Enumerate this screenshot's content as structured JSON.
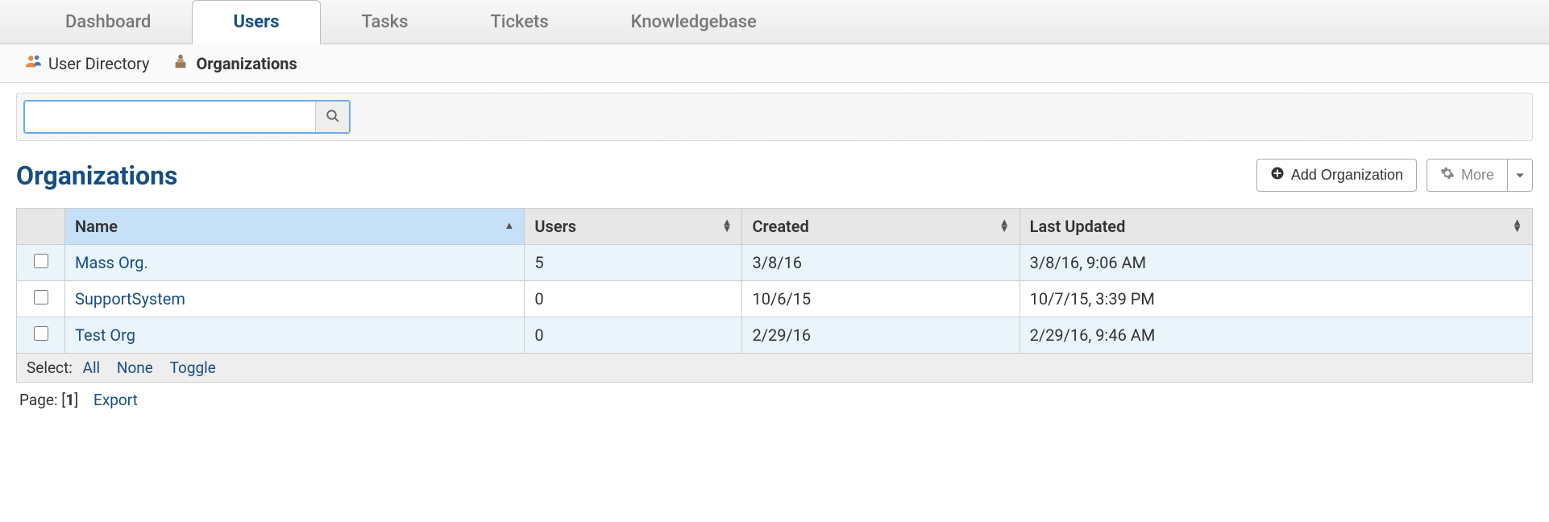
{
  "mainTabs": {
    "dashboard": "Dashboard",
    "users": "Users",
    "tasks": "Tasks",
    "tickets": "Tickets",
    "knowledgebase": "Knowledgebase"
  },
  "subNav": {
    "userDirectory": "User Directory",
    "organizations": "Organizations"
  },
  "page": {
    "title": "Organizations"
  },
  "actions": {
    "addOrganization": "Add Organization",
    "more": "More"
  },
  "table": {
    "columns": {
      "name": "Name",
      "users": "Users",
      "created": "Created",
      "lastUpdated": "Last Updated"
    },
    "rows": [
      {
        "name": "Mass Org.",
        "users": "5",
        "created": "3/8/16",
        "lastUpdated": "3/8/16, 9:06 AM"
      },
      {
        "name": "SupportSystem",
        "users": "0",
        "created": "10/6/15",
        "lastUpdated": "10/7/15, 3:39 PM"
      },
      {
        "name": "Test Org",
        "users": "0",
        "created": "2/29/16",
        "lastUpdated": "2/29/16, 9:46 AM"
      }
    ],
    "selectLabel": "Select:",
    "selectAll": "All",
    "selectNone": "None",
    "selectToggle": "Toggle"
  },
  "pagination": {
    "pageLabel": "Page:",
    "current": "1",
    "export": "Export"
  },
  "search": {
    "placeholder": ""
  }
}
